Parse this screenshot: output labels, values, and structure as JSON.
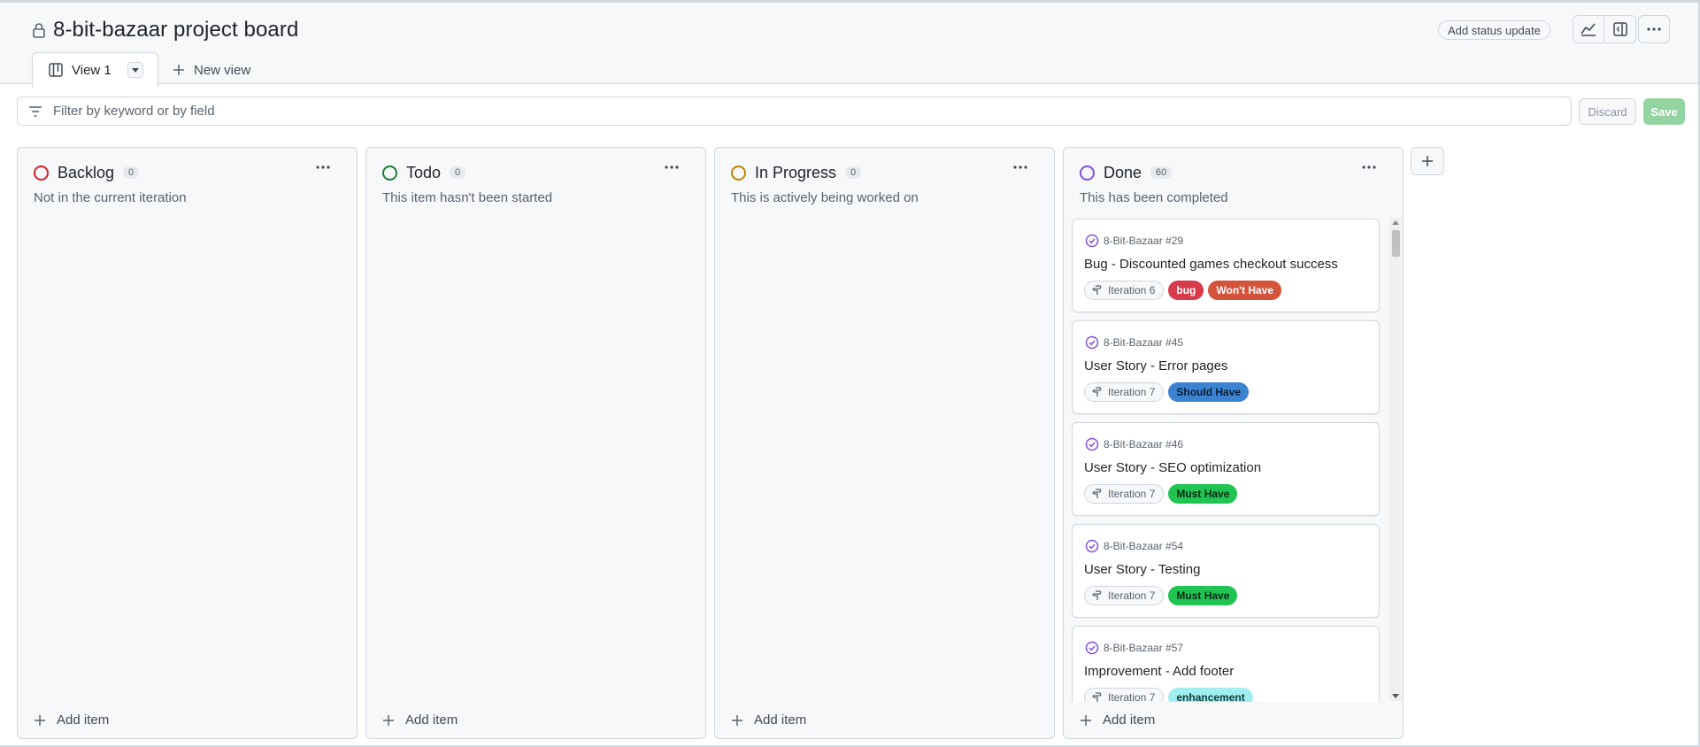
{
  "project": {
    "title": "8-bit-bazaar project board",
    "status_update_label": "Add status update"
  },
  "tabs": {
    "active_label": "View 1",
    "new_view_label": "New view"
  },
  "filter": {
    "placeholder": "Filter by keyword or by field",
    "discard_label": "Discard",
    "save_label": "Save"
  },
  "add_item_label": "Add item",
  "columns": [
    {
      "name": "Backlog",
      "count": "0",
      "description": "Not in the current iteration",
      "color": "#cf222e"
    },
    {
      "name": "Todo",
      "count": "0",
      "description": "This item hasn't been started",
      "color": "#1a7f37"
    },
    {
      "name": "In Progress",
      "count": "0",
      "description": "This is actively being worked on",
      "color": "#bf8700"
    },
    {
      "name": "Done",
      "count": "60",
      "description": "This has been completed",
      "color": "#8250df"
    }
  ],
  "done_cards": [
    {
      "ref": "8-Bit-Bazaar #29",
      "title": "Bug - Discounted games checkout success",
      "iteration": "Iteration 6",
      "labels": [
        {
          "text": "bug",
          "bg": "#d73a4a",
          "fg": "#ffffff"
        },
        {
          "text": "Won't Have",
          "bg": "#d4533b",
          "fg": "#ffffff"
        }
      ]
    },
    {
      "ref": "8-Bit-Bazaar #45",
      "title": "User Story - Error pages",
      "iteration": "Iteration 7",
      "labels": [
        {
          "text": "Should Have",
          "bg": "#3b82d0",
          "fg": "#0b1f35"
        }
      ]
    },
    {
      "ref": "8-Bit-Bazaar #46",
      "title": "User Story - SEO optimization",
      "iteration": "Iteration 7",
      "labels": [
        {
          "text": "Must Have",
          "bg": "#1fc452",
          "fg": "#0a2a12"
        }
      ]
    },
    {
      "ref": "8-Bit-Bazaar #54",
      "title": "User Story - Testing",
      "iteration": "Iteration 7",
      "labels": [
        {
          "text": "Must Have",
          "bg": "#1fc452",
          "fg": "#0a2a12"
        }
      ]
    },
    {
      "ref": "8-Bit-Bazaar #57",
      "title": "Improvement - Add footer",
      "iteration": "Iteration 7",
      "labels": [
        {
          "text": "enhancement",
          "bg": "#a2eeef",
          "fg": "#0b3d3e"
        }
      ]
    }
  ]
}
